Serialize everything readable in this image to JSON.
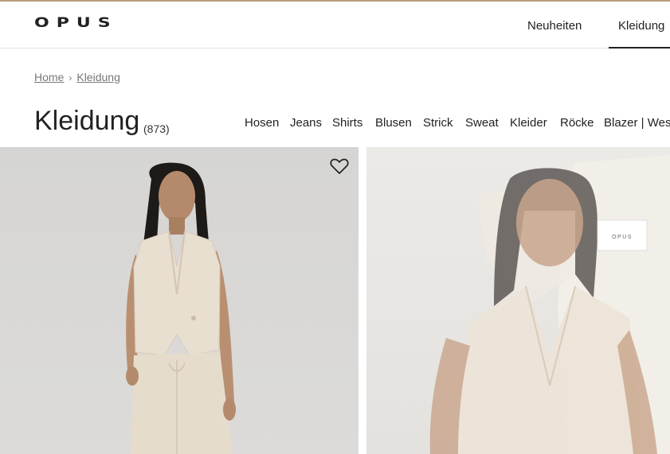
{
  "header": {
    "logo": "OPUS",
    "nav": [
      "Neuheiten",
      "Kleidung"
    ],
    "active_nav": "Kleidung"
  },
  "breadcrumb": {
    "home": "Home",
    "separator": "›",
    "current": "Kleidung"
  },
  "page": {
    "title": "Kleidung",
    "count": "(873)"
  },
  "categories": [
    "Hosen",
    "Jeans",
    "Shirts",
    "Blusen",
    "Strick",
    "Sweat",
    "Kleider",
    "Röcke",
    "Blazer | Weste"
  ],
  "products": [
    {
      "icon": "heart-icon",
      "image": "product-image-sleeveless-vest-beige"
    },
    {
      "image": "product-image-vest-detail-overlay",
      "tag_text": "OPUS"
    }
  ],
  "colors": {
    "accent_topline": "#b79f7c",
    "text": "#222222",
    "link": "#777777",
    "beige": "#e7ddd0"
  }
}
